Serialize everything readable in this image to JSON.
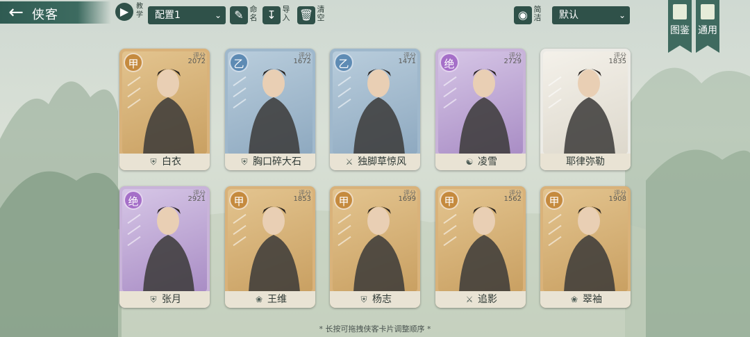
{
  "header": {
    "title": "侠客",
    "tutorial_label": "教学",
    "config_select": "配置1",
    "rename_label": "命名",
    "import_label": "导入",
    "clear_label": "清空",
    "simple_label": "简洁",
    "sort_select": "默认",
    "gallery_label": "图鉴",
    "common_label": "通用"
  },
  "score_label": "评分",
  "cards": [
    {
      "name": "白衣",
      "grade": "甲",
      "score": "2072",
      "tier": "gold",
      "icon": "shield-icon"
    },
    {
      "name": "胸口碎大石",
      "grade": "乙",
      "score": "1672",
      "tier": "blue",
      "icon": "shield-icon"
    },
    {
      "name": "独脚草惊风",
      "grade": "乙",
      "score": "1471",
      "tier": "blue",
      "icon": "sword-icon"
    },
    {
      "name": "凌雪",
      "grade": "绝",
      "score": "2729",
      "tier": "purple",
      "icon": "yinyang-icon"
    },
    {
      "name": "耶律弥勒",
      "grade": "",
      "score": "1835",
      "tier": "white",
      "icon": ""
    },
    {
      "name": "张月",
      "grade": "绝",
      "score": "2921",
      "tier": "purple",
      "icon": "shield-icon"
    },
    {
      "name": "王维",
      "grade": "甲",
      "score": "1853",
      "tier": "gold",
      "icon": "lotus-icon"
    },
    {
      "name": "杨志",
      "grade": "甲",
      "score": "1699",
      "tier": "gold",
      "icon": "shield-icon"
    },
    {
      "name": "追影",
      "grade": "甲",
      "score": "1562",
      "tier": "gold",
      "icon": "sword-icon"
    },
    {
      "name": "翠袖",
      "grade": "甲",
      "score": "1908",
      "tier": "gold",
      "icon": "lotus-icon"
    }
  ],
  "footer_hint": "* 长按可拖拽侠客卡片调整顺序 *",
  "colors": {
    "gold": "#d9b27a",
    "blue": "#9fb8cc",
    "purple": "#c8b3d9",
    "white": "#ecebe6",
    "badge_gold": "#c58a3e",
    "badge_blue": "#5e8bb4",
    "badge_purple": "#a56fc8"
  }
}
